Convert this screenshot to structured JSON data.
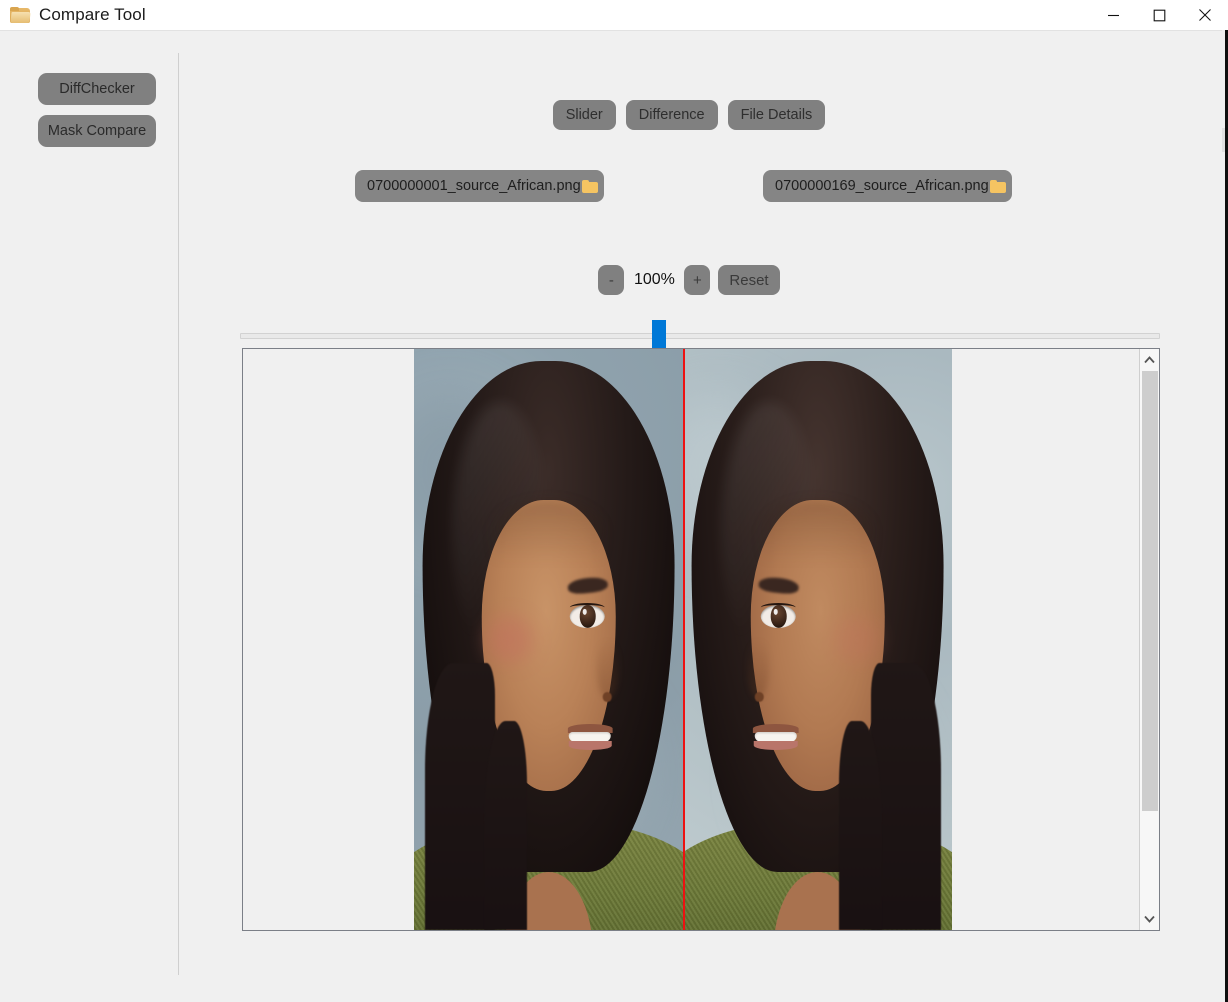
{
  "window": {
    "title": "Compare Tool",
    "icon": "folder-icon",
    "controls": {
      "minimize": "minimize-icon",
      "maximize": "maximize-icon",
      "close": "close-icon"
    }
  },
  "sidebar": {
    "items": [
      {
        "label": "DiffChecker"
      },
      {
        "label": "Mask Compare"
      }
    ]
  },
  "main": {
    "modes": [
      {
        "label": "Slider"
      },
      {
        "label": "Difference"
      },
      {
        "label": "File Details"
      }
    ],
    "files": {
      "left": {
        "name": "0700000001_source_African.png",
        "icon": "folder-icon"
      },
      "right": {
        "name": "0700000169_source_African.png",
        "icon": "folder-icon"
      }
    },
    "zoom": {
      "minus_label": "-",
      "value": "100%",
      "plus_label": "+",
      "reset_label": "Reset"
    },
    "slider": {
      "position_percent": 45
    },
    "viewer": {
      "divider_color": "#ee1111",
      "scrollbar": {
        "up_icon": "chevron-up-icon",
        "down_icon": "chevron-down-icon"
      }
    }
  },
  "colors": {
    "button_gray": "#808080",
    "chip_gray": "#858585",
    "accent_blue": "#0078d7",
    "panel_bg": "#f0f0f0",
    "divider_red": "#ee1111",
    "folder_yellow": "#f5c462"
  }
}
